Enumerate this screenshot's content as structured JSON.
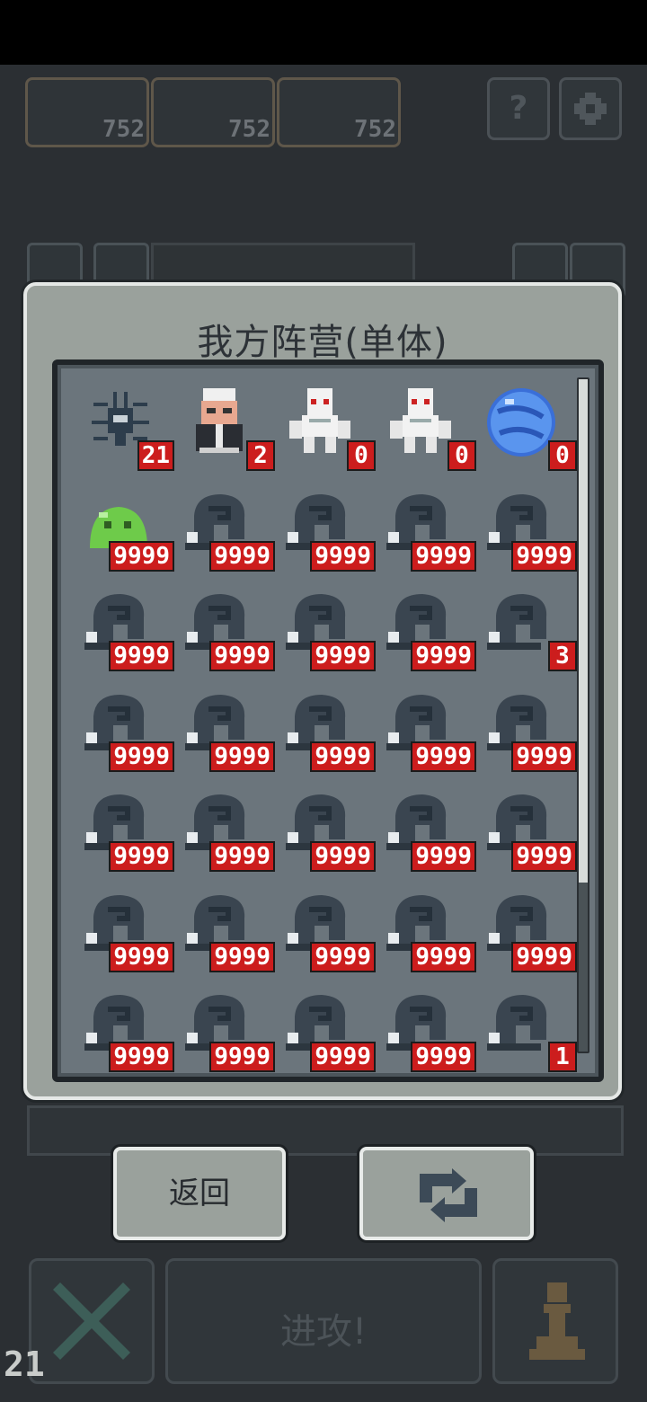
{
  "resources": [
    {
      "label": "752"
    },
    {
      "label": "752"
    },
    {
      "label": "752"
    }
  ],
  "top_buttons": {
    "help": "?"
  },
  "modal": {
    "title": "我方阵营(单体)",
    "units": [
      {
        "icon": "spider-icon",
        "count": "21"
      },
      {
        "icon": "old-man-icon",
        "count": "2"
      },
      {
        "icon": "white-robot-icon",
        "count": "0"
      },
      {
        "icon": "white-robot-icon",
        "count": "0"
      },
      {
        "icon": "blue-orb-icon",
        "count": "0"
      },
      {
        "icon": "green-slime-icon",
        "count": "9999"
      },
      {
        "icon": "shadow-ghost-icon",
        "count": "9999"
      },
      {
        "icon": "shadow-ghost-icon",
        "count": "9999"
      },
      {
        "icon": "shadow-ghost-icon",
        "count": "9999"
      },
      {
        "icon": "shadow-ghost-icon",
        "count": "9999"
      },
      {
        "icon": "shadow-ghost-icon",
        "count": "9999"
      },
      {
        "icon": "shadow-ghost-icon",
        "count": "9999"
      },
      {
        "icon": "shadow-ghost-icon",
        "count": "9999"
      },
      {
        "icon": "shadow-ghost-icon",
        "count": "9999"
      },
      {
        "icon": "shadow-ghost-icon",
        "count": "3"
      },
      {
        "icon": "shadow-ghost-icon",
        "count": "9999"
      },
      {
        "icon": "shadow-ghost-icon",
        "count": "9999"
      },
      {
        "icon": "shadow-ghost-icon",
        "count": "9999"
      },
      {
        "icon": "shadow-ghost-icon",
        "count": "9999"
      },
      {
        "icon": "shadow-ghost-icon",
        "count": "9999"
      },
      {
        "icon": "shadow-ghost-icon",
        "count": "9999"
      },
      {
        "icon": "shadow-ghost-icon",
        "count": "9999"
      },
      {
        "icon": "shadow-ghost-icon",
        "count": "9999"
      },
      {
        "icon": "shadow-ghost-icon",
        "count": "9999"
      },
      {
        "icon": "shadow-ghost-icon",
        "count": "9999"
      },
      {
        "icon": "shadow-ghost-icon",
        "count": "9999"
      },
      {
        "icon": "shadow-ghost-icon",
        "count": "9999"
      },
      {
        "icon": "shadow-ghost-icon",
        "count": "9999"
      },
      {
        "icon": "shadow-ghost-icon",
        "count": "9999"
      },
      {
        "icon": "shadow-ghost-icon",
        "count": "9999"
      },
      {
        "icon": "shadow-ghost-icon",
        "count": "9999"
      },
      {
        "icon": "shadow-ghost-icon",
        "count": "9999"
      },
      {
        "icon": "shadow-ghost-icon",
        "count": "9999"
      },
      {
        "icon": "shadow-ghost-icon",
        "count": "9999"
      },
      {
        "icon": "shadow-ghost-icon",
        "count": "1"
      }
    ]
  },
  "buttons": {
    "back": "返回",
    "attack": "进攻!"
  },
  "bottom_counter": "21",
  "colors": {
    "badge": "#cc1d1d",
    "panel": "#9aa19c",
    "grid_bg": "#6b757c"
  }
}
